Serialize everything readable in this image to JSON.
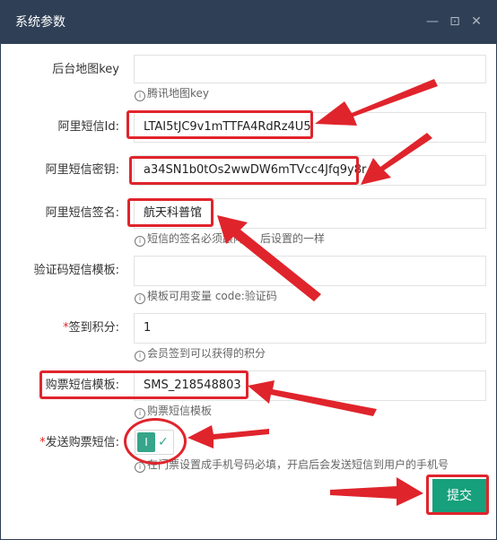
{
  "dialog": {
    "title": "系统参数",
    "min_icon": "—",
    "max_icon": "⊡",
    "close_icon": "✕"
  },
  "fields": [
    {
      "label": "后台地图key",
      "value": "",
      "hint": "腾讯地图key",
      "required": false
    },
    {
      "label": "阿里短信Id:",
      "value": "LTAI5tJC9v1mTTFA4RdRz4U5",
      "hint": "",
      "required": false
    },
    {
      "label": "阿里短信密钥:",
      "value": "a34SN1b0tOs2wwDW6mTVcc4Jfq9y8r",
      "hint": "",
      "required": false
    },
    {
      "label": "阿里短信签名:",
      "value": "航天科普馆",
      "hint": "短信的签名必须跟阿",
      "hint_tail": "后设置的一样",
      "required": false
    },
    {
      "label": "验证码短信模板:",
      "value": "",
      "hint": "模板可用变量 code:验证码",
      "required": false
    },
    {
      "label": "签到积分:",
      "value": "1",
      "hint": "会员签到可以获得的积分",
      "required": true
    },
    {
      "label": "购票短信模板:",
      "value": "SMS_218548803",
      "hint": "购票短信模板",
      "required": false
    }
  ],
  "toggle": {
    "label": "发送购票短信:",
    "required": true,
    "state_on_text": "I",
    "check_glyph": "✓",
    "hint": "在门票设置成手机号码必填，开启后会发送短信到用户的手机号"
  },
  "submit_label": "提交",
  "hint_icon": "i",
  "colors": {
    "titlebar": "#2f4056",
    "accent": "#16a07c",
    "annotation": "#e0242c"
  }
}
